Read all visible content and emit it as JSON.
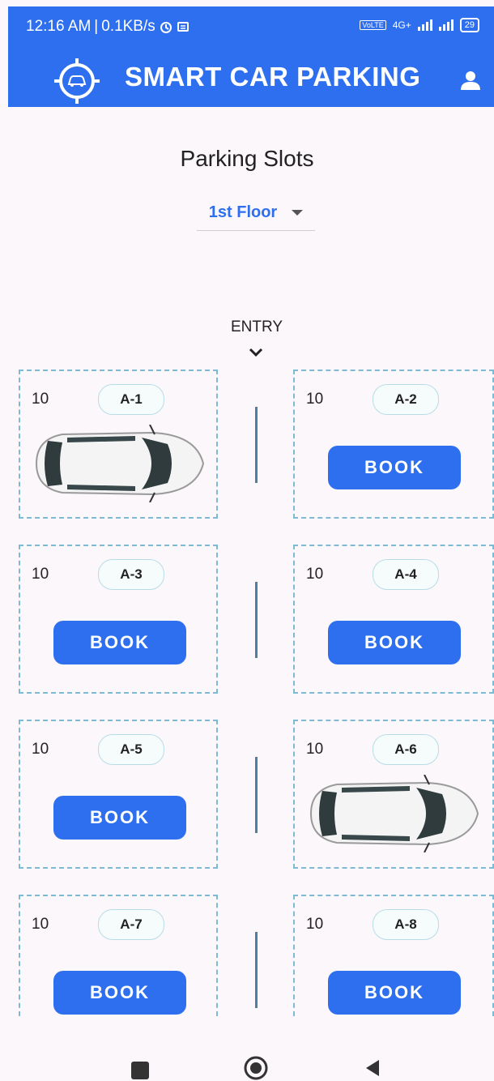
{
  "status_bar": {
    "time": "12:16 AM",
    "speed": "0.1KB/s",
    "network": "4G+",
    "battery": "29"
  },
  "app_bar": {
    "title": "SMART CAR PARKING",
    "logo_icon": "car-target-icon",
    "profile_icon": "person-icon",
    "color": "#2e6ff0"
  },
  "page": {
    "title": "Parking Slots",
    "floor_select": {
      "selected": "1st Floor"
    },
    "entry_label": "ENTRY"
  },
  "slots": [
    {
      "count": "10",
      "id": "A-1",
      "occupied": true
    },
    {
      "count": "10",
      "id": "A-2",
      "occupied": false,
      "action": "BOOK"
    },
    {
      "count": "10",
      "id": "A-3",
      "occupied": false,
      "action": "BOOK"
    },
    {
      "count": "10",
      "id": "A-4",
      "occupied": false,
      "action": "BOOK"
    },
    {
      "count": "10",
      "id": "A-5",
      "occupied": false,
      "action": "BOOK"
    },
    {
      "count": "10",
      "id": "A-6",
      "occupied": true
    },
    {
      "count": "10",
      "id": "A-7",
      "occupied": false,
      "action": "BOOK"
    },
    {
      "count": "10",
      "id": "A-8",
      "occupied": false,
      "action": "BOOK"
    }
  ],
  "nav_bar": {
    "icons": [
      "recent-apps-icon",
      "home-icon",
      "back-icon"
    ]
  }
}
